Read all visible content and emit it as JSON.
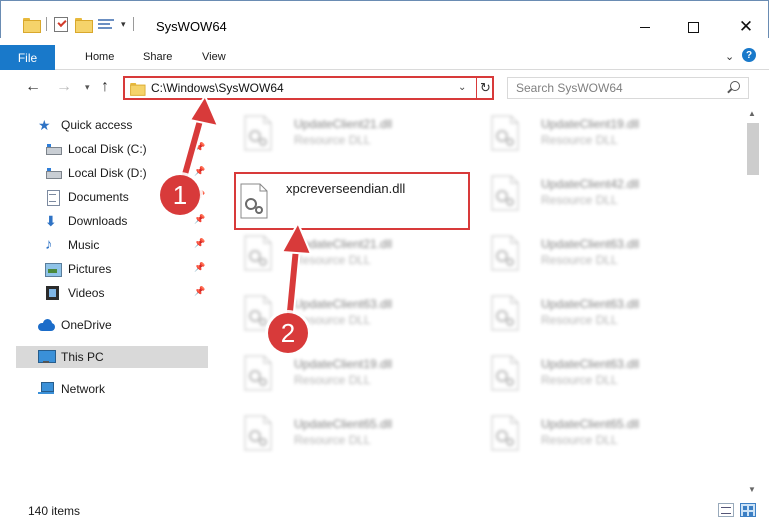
{
  "window": {
    "title": "SysWOW64"
  },
  "ribbon": {
    "tabs": [
      "File",
      "Home",
      "Share",
      "View"
    ]
  },
  "address": {
    "path": "C:\\Windows\\SysWOW64"
  },
  "search": {
    "placeholder": "Search SysWOW64"
  },
  "sidebar": {
    "items": [
      {
        "label": "Quick access",
        "icon": "star-icon"
      },
      {
        "label": "Local Disk (C:)",
        "icon": "drive-icon"
      },
      {
        "label": "Local Disk (D:)",
        "icon": "drive-icon"
      },
      {
        "label": "Documents",
        "icon": "documents-icon"
      },
      {
        "label": "Downloads",
        "icon": "downloads-icon"
      },
      {
        "label": "Music",
        "icon": "music-icon"
      },
      {
        "label": "Pictures",
        "icon": "pictures-icon"
      },
      {
        "label": "Videos",
        "icon": "videos-icon"
      },
      {
        "label": "OneDrive",
        "icon": "onedrive-icon"
      },
      {
        "label": "This PC",
        "icon": "this-pc-icon",
        "selected": true
      },
      {
        "label": "Network",
        "icon": "network-icon"
      }
    ]
  },
  "files": {
    "focused": {
      "name": "xpcreverseendian.dll"
    },
    "items": [
      {
        "name": "UpdateClient21.dll",
        "type": "Resource DLL"
      },
      {
        "name": "UpdateClient19.dll",
        "type": "Resource DLL"
      },
      {
        "name": "UpdateClient42.dll",
        "type": "Resource DLL"
      },
      {
        "name": "UpdateClient21.dll",
        "type": "Resource DLL"
      },
      {
        "name": "UpdateClient63.dll",
        "type": "Resource DLL"
      },
      {
        "name": "UpdateClient63.dll",
        "type": "Resource DLL"
      },
      {
        "name": "UpdateClient63.dll",
        "type": "Resource DLL"
      },
      {
        "name": "UpdateClient19.dll",
        "type": "Resource DLL"
      },
      {
        "name": "UpdateClient63.dll",
        "type": "Resource DLL"
      },
      {
        "name": "UpdateClient65.dll",
        "type": "Resource DLL"
      },
      {
        "name": "UpdateClient65.dll",
        "type": "Resource DLL"
      }
    ]
  },
  "status": {
    "item_count": "140 items"
  },
  "annotations": {
    "step1": "1",
    "step2": "2",
    "color": "#d83a3a"
  }
}
